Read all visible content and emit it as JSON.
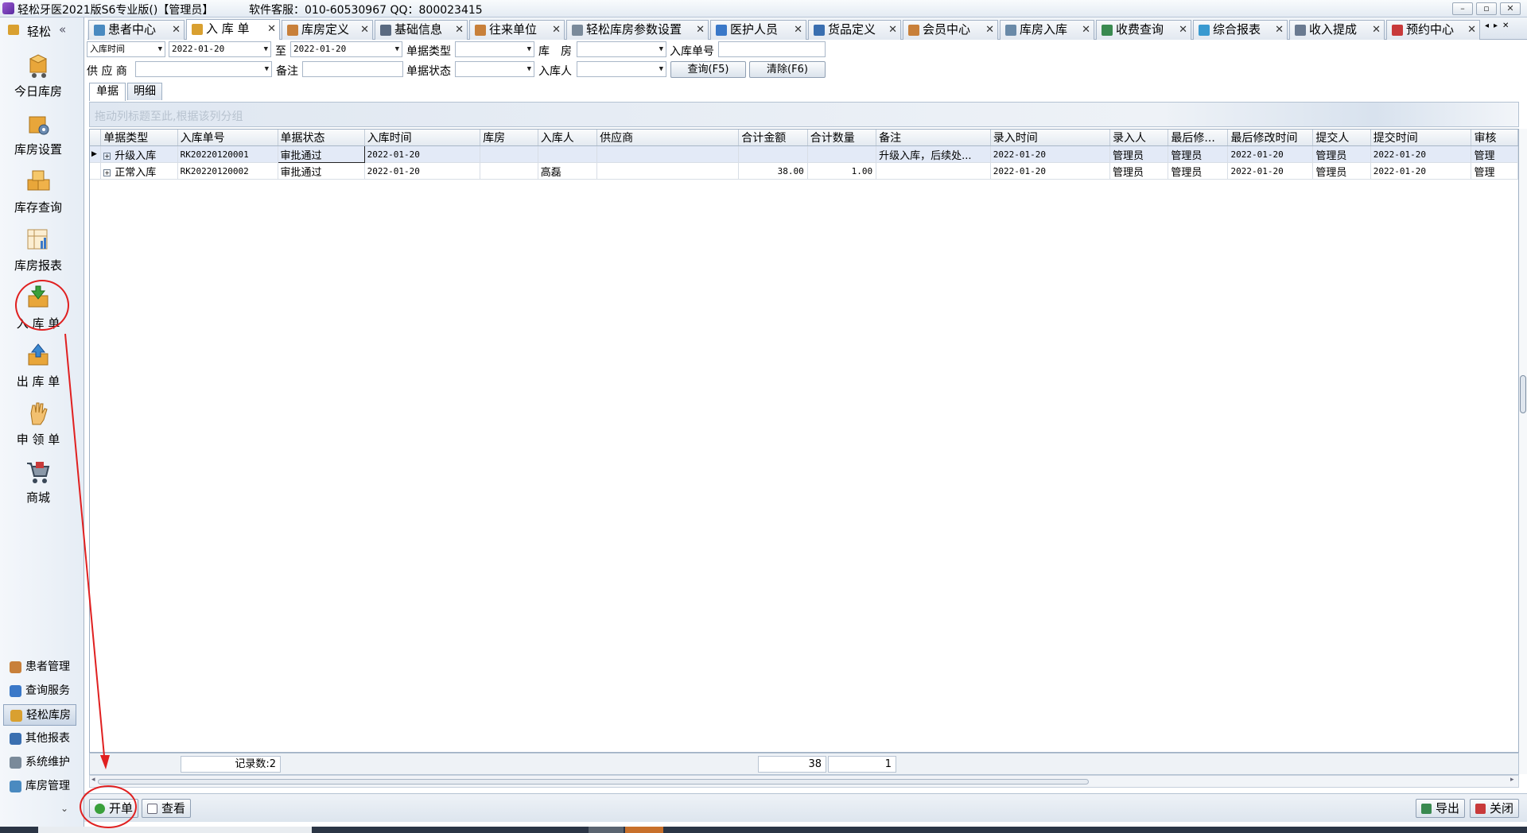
{
  "window": {
    "title": "轻松牙医2021版S6专业版()【管理员】",
    "service": "软件客服：010-60530967 QQ：800023415",
    "controls": [
      "–",
      "▫",
      "✕"
    ]
  },
  "sidebar": {
    "header": "轻松",
    "collapse": "«",
    "items": [
      {
        "label": "今日库房",
        "icon": "box-cart-icon"
      },
      {
        "label": "库房设置",
        "icon": "box-gear-icon"
      },
      {
        "label": "库存查询",
        "icon": "boxes-icon"
      },
      {
        "label": "库房报表",
        "icon": "report-chart-icon"
      },
      {
        "label": "入 库 单",
        "icon": "inbox-in-icon"
      },
      {
        "label": "出 库 单",
        "icon": "inbox-out-icon"
      },
      {
        "label": "申 领 单",
        "icon": "hand-icon"
      },
      {
        "label": "商城",
        "icon": "shopping-cart-icon"
      }
    ],
    "modules": [
      {
        "label": "患者管理",
        "color": "#c8803a"
      },
      {
        "label": "查询服务",
        "color": "#3a78c8"
      },
      {
        "label": "轻松库房",
        "color": "#d9a030"
      },
      {
        "label": "其他报表",
        "color": "#3a6fb0"
      },
      {
        "label": "系统维护",
        "color": "#7a8a9a"
      },
      {
        "label": "库房管理",
        "color": "#4a8ac0"
      }
    ],
    "more": "⌄"
  },
  "tabs": [
    {
      "label": "患者中心",
      "color": "#4a8ac0"
    },
    {
      "label": "入 库 单",
      "color": "#d9a030"
    },
    {
      "label": "库房定义",
      "color": "#c8803a"
    },
    {
      "label": "基础信息",
      "color": "#5a6a80"
    },
    {
      "label": "往来单位",
      "color": "#c8803a"
    },
    {
      "label": "轻松库房参数设置",
      "color": "#7a8a9a"
    },
    {
      "label": "医护人员",
      "color": "#3a78c8"
    },
    {
      "label": "货品定义",
      "color": "#3a6fb0"
    },
    {
      "label": "会员中心",
      "color": "#c8803a"
    },
    {
      "label": "库房入库",
      "color": "#6a8aa8"
    },
    {
      "label": "收费查询",
      "color": "#3a8a50"
    },
    {
      "label": "综合报表",
      "color": "#3a9ad0"
    },
    {
      "label": "收入提成",
      "color": "#6a7a90"
    },
    {
      "label": "预约中心",
      "color": "#c83a3a"
    }
  ],
  "filters": {
    "date_type": "入库时间",
    "date_from": "2022-01-20",
    "to_label": "至",
    "date_to": "2022-01-20",
    "doc_type_label": "单据类型",
    "doc_type": "",
    "warehouse_label": "库　房",
    "warehouse": "",
    "doc_no_label": "入库单号",
    "doc_no": "",
    "supplier_label": "供 应 商",
    "supplier": "",
    "remark_label": "备注",
    "remark": "",
    "status_label": "单据状态",
    "status": "",
    "receiver_label": "入库人",
    "receiver": "",
    "query_button": "查询(F5)",
    "clear_button": "清除(F6)"
  },
  "subtabs": [
    "单据",
    "明细"
  ],
  "group_hint": "拖动列标题至此,根据该列分组",
  "grid": {
    "columns": [
      "单据类型",
      "入库单号",
      "单据状态",
      "入库时间",
      "库房",
      "入库人",
      "供应商",
      "合计金额",
      "合计数量",
      "备注",
      "录入时间",
      "录入人",
      "最后修...",
      "最后修改时间",
      "提交人",
      "提交时间",
      "审核"
    ],
    "rows": [
      [
        "升级入库",
        "RK20220120001",
        "审批通过",
        "2022-01-20",
        "",
        "",
        "",
        "",
        "",
        "升级入库，后续处...",
        "2022-01-20",
        "管理员",
        "管理员",
        "2022-01-20",
        "管理员",
        "2022-01-20",
        "管理"
      ],
      [
        "正常入库",
        "RK20220120002",
        "审批通过",
        "2022-01-20",
        "",
        "高磊",
        "",
        "38.00",
        "1.00",
        "",
        "2022-01-20",
        "管理员",
        "管理员",
        "2022-01-20",
        "管理员",
        "2022-01-20",
        "管理"
      ]
    ]
  },
  "footer": {
    "record_count": "记录数:2",
    "total_amount": "38",
    "total_qty": "1"
  },
  "bottom": {
    "new_button": "开单",
    "view_button": "查看",
    "export_button": "导出",
    "close_button": "关闭"
  },
  "accent": "#e02020"
}
